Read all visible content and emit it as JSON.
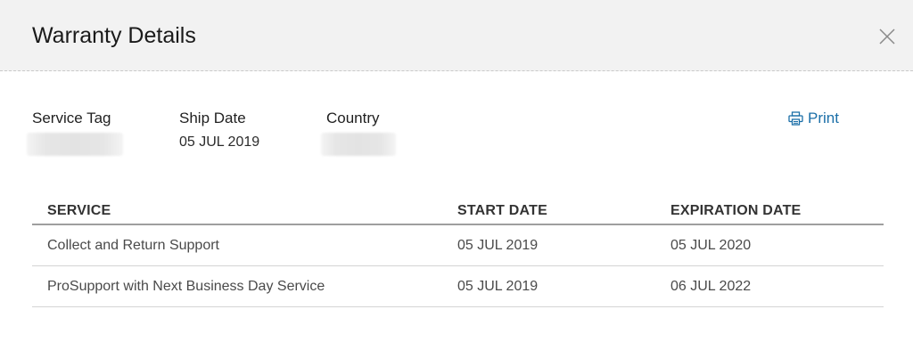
{
  "dialog": {
    "title": "Warranty Details"
  },
  "summary": {
    "service_tag_label": "Service Tag",
    "ship_date_label": "Ship Date",
    "ship_date_value": "05 JUL 2019",
    "country_label": "Country"
  },
  "print": {
    "label": "Print"
  },
  "table": {
    "headers": [
      "SERVICE",
      "START DATE",
      "EXPIRATION DATE"
    ],
    "rows": [
      {
        "service": "Collect and Return Support",
        "start": "05 JUL 2019",
        "expiration": "05 JUL 2020"
      },
      {
        "service": "ProSupport with Next Business Day Service",
        "start": "05 JUL 2019",
        "expiration": "06 JUL 2022"
      }
    ]
  },
  "icons": {
    "close": "close-icon",
    "print": "printer-icon"
  },
  "colors": {
    "header_bg": "#f2f2f2",
    "link": "#1b6fa8",
    "text": "#1a1a1a"
  }
}
